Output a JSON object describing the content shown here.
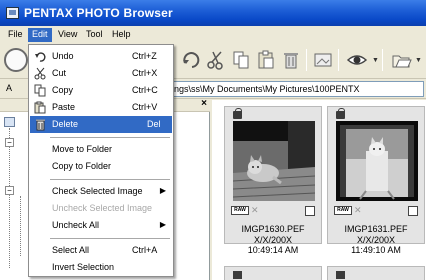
{
  "window": {
    "title": "PENTAX PHOTO Browser"
  },
  "menubar": {
    "items": [
      {
        "label": "File"
      },
      {
        "label": "Edit"
      },
      {
        "label": "View"
      },
      {
        "label": "Tool"
      },
      {
        "label": "Help"
      }
    ],
    "active": "Edit"
  },
  "address": {
    "label": "A",
    "value": "ngs\\ss\\My Documents\\My Pictures\\100PENTX"
  },
  "edit_menu": {
    "items": [
      {
        "label": "Undo",
        "shortcut": "Ctrl+Z",
        "icon": "undo-icon",
        "enabled": true
      },
      {
        "label": "Cut",
        "shortcut": "Ctrl+X",
        "icon": "scissors-icon",
        "enabled": true
      },
      {
        "label": "Copy",
        "shortcut": "Ctrl+C",
        "icon": "copy-icon",
        "enabled": true
      },
      {
        "label": "Paste",
        "shortcut": "Ctrl+V",
        "icon": "paste-icon",
        "enabled": true
      },
      {
        "label": "Delete",
        "shortcut": "Del",
        "icon": "trash-icon",
        "enabled": true,
        "highlighted": true
      },
      {
        "label": "Move to Folder",
        "enabled": true
      },
      {
        "label": "Copy to Folder",
        "enabled": true
      },
      {
        "label": "Check Selected Image",
        "enabled": true,
        "submenu": true
      },
      {
        "label": "Uncheck Selected Image",
        "enabled": false
      },
      {
        "label": "Uncheck All",
        "enabled": true,
        "submenu": true
      },
      {
        "label": "Select All",
        "shortcut": "Ctrl+A",
        "enabled": true
      },
      {
        "label": "Invert Selection",
        "enabled": true
      }
    ]
  },
  "thumbnails": [
    {
      "filename": "IMGP1630.PEF",
      "date": "X/X/200X",
      "time": "10:49:14 AM",
      "badge": "RAW",
      "checked": false
    },
    {
      "filename": "IMGP1631.PEF",
      "date": "X/X/200X",
      "time": "11:49:10 AM",
      "badge": "RAW",
      "checked": false
    }
  ],
  "colors": {
    "title_bar": "#0a49c8",
    "menu_highlight": "#316ac5",
    "disabled_text": "#a8a8a8"
  }
}
